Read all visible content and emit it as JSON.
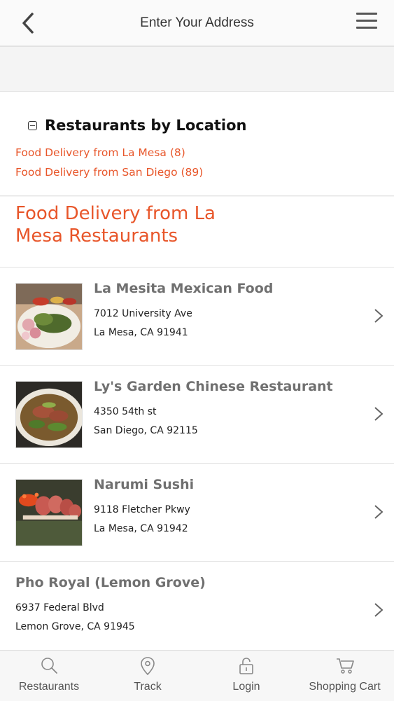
{
  "header": {
    "title": "Enter Your Address",
    "back_icon": "chevron-left-icon",
    "menu_icon": "hamburger-menu-icon"
  },
  "locations": {
    "heading": "Restaurants by Location",
    "links": [
      "Food Delivery from La Mesa (8)",
      "Food Delivery from San Diego (89)"
    ]
  },
  "section": {
    "title": "Food Delivery from La Mesa Restaurants"
  },
  "restaurants": [
    {
      "name": "La Mesita Mexican Food",
      "address1": "7012 University Ave",
      "address2": "La Mesa, CA 91941",
      "image": "mexican-food-photo"
    },
    {
      "name": "Ly's Garden Chinese Restaurant",
      "address1": "4350 54th st",
      "address2": "San Diego, CA 92115",
      "image": "noodle-soup-photo"
    },
    {
      "name": "Narumi Sushi",
      "address1": "9118 Fletcher Pkwy",
      "address2": "La Mesa, CA 91942",
      "image": "sushi-photo"
    },
    {
      "name": "Pho Royal (Lemon Grove)",
      "address1": "6937 Federal Blvd",
      "address2": "Lemon Grove, CA 91945",
      "image": ""
    }
  ],
  "bottom_nav": [
    {
      "label": "Restaurants",
      "icon": "search-icon"
    },
    {
      "label": "Track",
      "icon": "map-pin-icon"
    },
    {
      "label": "Login",
      "icon": "lock-icon"
    },
    {
      "label": "Shopping Cart",
      "icon": "cart-icon"
    }
  ],
  "colors": {
    "accent": "#e8562a",
    "name_gray": "#707070"
  }
}
